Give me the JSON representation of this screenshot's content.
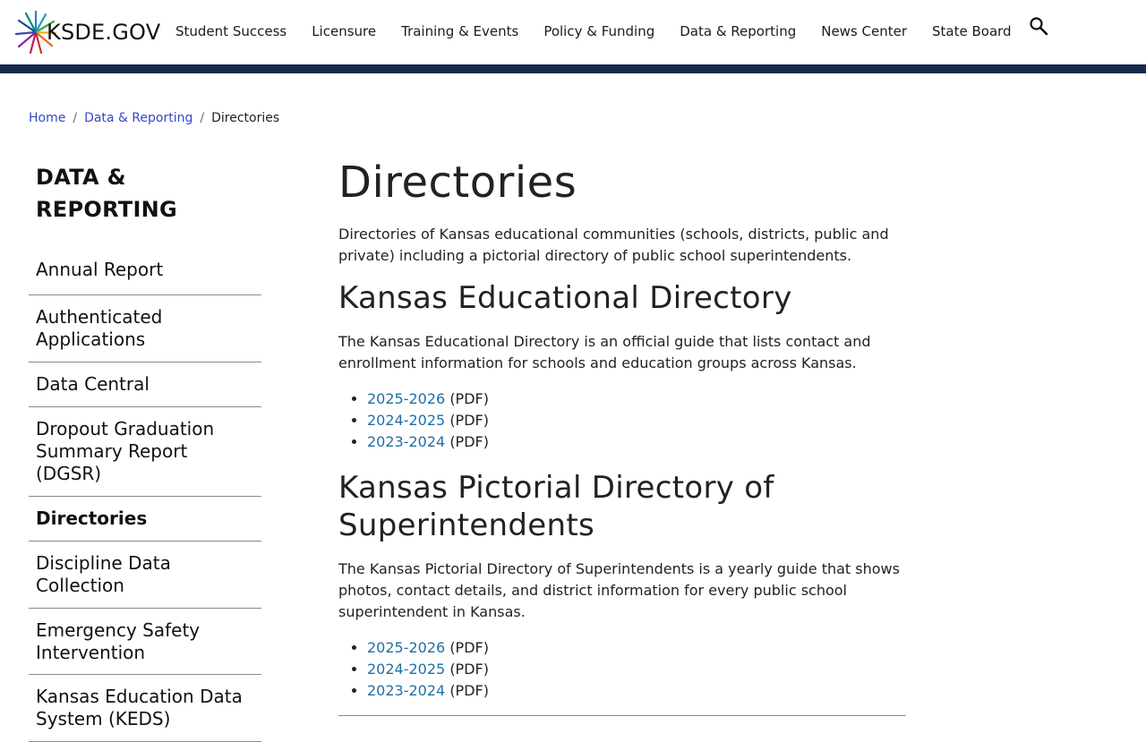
{
  "site": {
    "logo_text": "KSDE.GOV",
    "nav": [
      "Student Success",
      "Licensure",
      "Training & Events",
      "Policy & Funding",
      "Data & Reporting",
      "News Center",
      "State Board"
    ],
    "colors": {
      "header_bar": "#162a4a",
      "link": "#1f6fa6",
      "breadcrumb_link": "#3548c9"
    }
  },
  "breadcrumb": {
    "home": "Home",
    "parent": "Data & Reporting",
    "current": "Directories",
    "separator": "/"
  },
  "sidebar": {
    "title": "DATA & REPORTING",
    "items": [
      "Annual Report",
      "Authenticated Applications",
      "Data Central",
      "Dropout Graduation Summary Report (DGSR)",
      "Directories",
      "Discipline Data Collection",
      "Emergency Safety Intervention",
      "Kansas Education Data System (KEDS)"
    ],
    "active_index": 4
  },
  "main": {
    "title": "Directories",
    "intro": "Directories of Kansas educational communities (schools, districts, public and private) including a pictorial directory of public school superintendents.",
    "sections": [
      {
        "heading": "Kansas Educational Directory",
        "description": "The Kansas Educational Directory is an official guide that lists contact and enrollment information for schools and education groups across Kansas.",
        "links": [
          {
            "label": "2025-2026",
            "suffix": "(PDF)"
          },
          {
            "label": "2024-2025",
            "suffix": "(PDF)"
          },
          {
            "label": "2023-2024",
            "suffix": "(PDF)"
          }
        ]
      },
      {
        "heading": "Kansas Pictorial Directory of Superintendents",
        "description": "The Kansas Pictorial Directory of Superintendents is a yearly guide that shows photos, contact details, and district information for every public school superintendent in Kansas.",
        "links": [
          {
            "label": "2025-2026",
            "suffix": "(PDF)"
          },
          {
            "label": "2024-2025",
            "suffix": "(PDF)"
          },
          {
            "label": "2023-2024",
            "suffix": "(PDF)"
          }
        ]
      }
    ]
  }
}
